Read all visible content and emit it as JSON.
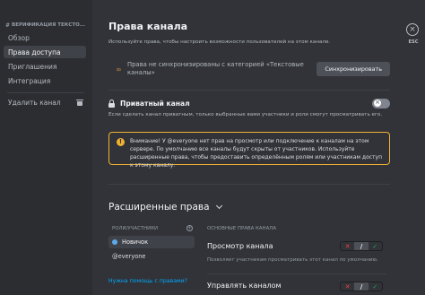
{
  "sidebar": {
    "channel_header": "ВЕРИФИКАЦИЯ ТЕКСТО...",
    "items": [
      {
        "label": "Обзор"
      },
      {
        "label": "Права доступа"
      },
      {
        "label": "Приглашения"
      },
      {
        "label": "Интеграция"
      },
      {
        "label": "Удалить канал"
      }
    ],
    "active_item": "Права доступа"
  },
  "main": {
    "title": "Права канала",
    "description": "Используйте права, чтобы настроить возможности пользователей на этом канале.",
    "sync_notice": "Права не синхронизированы с категорией «Текстовые каналы»",
    "sync_button": "Синхронизировать",
    "private_channel": {
      "label": "Приватный канал",
      "description": "Если сделать канал приватным, только выбранные вами участники и роли смогут просматривать его.",
      "enabled": false
    },
    "warning": "Внимание! У @everyone нет прав на просмотр или подключение к каналам на этом сервере. По умолчанию все каналы будут скрыты от участников. Используйте расширенные права, чтобы предоставить определённым ролям или участникам доступ к этому каналу.",
    "advanced": {
      "title": "Расширенные права",
      "roles_header": "РОЛИ/УЧАСТНИКИ",
      "roles": [
        {
          "name": "Новичок",
          "color": "#5da9e9"
        },
        {
          "name": "@everyone"
        }
      ],
      "help_link": "Нужна помощь с правами?",
      "perms_header": "ОСНОВНЫЕ ПРАВА КАНАЛА",
      "permissions": [
        {
          "title": "Просмотр канала",
          "description": "Позволяет участникам просматривать этот канал по умолчанию.",
          "state": "neutral"
        },
        {
          "title": "Управлять каналом",
          "state": "neutral"
        }
      ]
    }
  },
  "close": {
    "icon": "close-icon",
    "label": "ESC"
  },
  "icons": {
    "deny": "✕",
    "neutral": "/",
    "allow": "✓",
    "warning": "!",
    "sync": "∞"
  },
  "colors": {
    "warning": "#f0b232",
    "link": "#00a8fc",
    "deny": "#f23f43",
    "allow": "#23a55a"
  }
}
